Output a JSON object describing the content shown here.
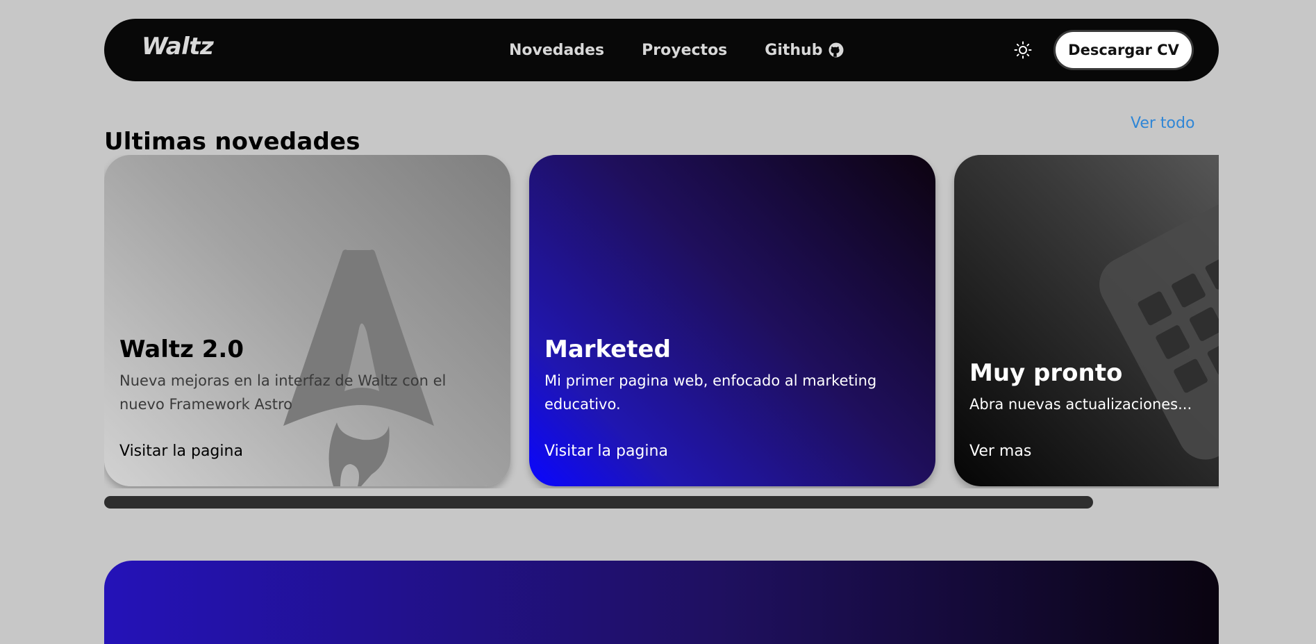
{
  "header": {
    "logo": "Waltz",
    "nav": [
      {
        "label": "Novedades"
      },
      {
        "label": "Proyectos"
      },
      {
        "label": "Github",
        "icon": "github-icon"
      }
    ],
    "theme_toggle_icon": "sun-icon",
    "cv_button": "Descargar CV"
  },
  "news": {
    "title": "Ultimas novedades",
    "see_all": "Ver todo",
    "cards": [
      {
        "title": "Waltz 2.0",
        "description": "Nueva mejoras en la interfaz de Waltz con el nuevo Framework Astro",
        "link": "Visitar la pagina",
        "art": "astro-logo"
      },
      {
        "title": "Marketed",
        "description": "Mi primer pagina web, enfocado al marketing educativo.",
        "link": "Visitar la pagina"
      },
      {
        "title": "Muy pronto",
        "description": "Abra nuevas actualizaciones...",
        "link": "Ver mas",
        "art": "calendar-icon"
      }
    ]
  },
  "colors": {
    "page_bg": "#c7c7c7",
    "nav_bg": "#080808",
    "link_accent": "#2f86d6"
  }
}
